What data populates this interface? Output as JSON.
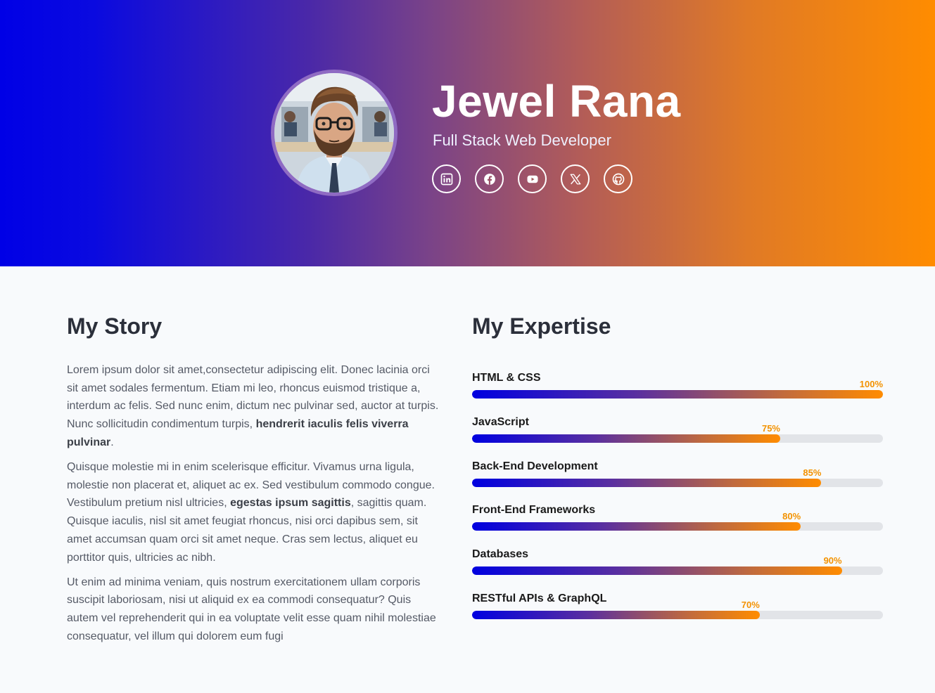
{
  "colors": {
    "gradient_start": "#0000e6",
    "gradient_end": "#ff8c00",
    "percent_text": "#f39200",
    "page_bg": "#f8fafc"
  },
  "hero": {
    "name": "Jewel Rana",
    "role": "Full Stack Web Developer",
    "avatar_icon": "avatar-portrait",
    "socials": [
      {
        "icon": "linkedin-icon"
      },
      {
        "icon": "facebook-icon"
      },
      {
        "icon": "youtube-icon"
      },
      {
        "icon": "x-twitter-icon"
      },
      {
        "icon": "github-icon"
      }
    ]
  },
  "story": {
    "title": "My Story",
    "paragraphs": [
      {
        "before": "Lorem ipsum dolor sit amet,consectetur adipiscing elit. Donec lacinia orci sit amet sodales fermentum. Etiam mi leo, rhoncus euismod tristique a, interdum ac felis. Sed nunc enim, dictum nec pulvinar sed, auctor at turpis. Nunc sollicitudin condimentum turpis, ",
        "bold": "hendrerit iaculis felis viverra pulvinar",
        "after": "."
      },
      {
        "before": "Quisque molestie mi in enim scelerisque efficitur. Vivamus urna ligula, molestie non placerat et, aliquet ac ex. Sed vestibulum commodo congue. Vestibulum pretium nisl ultricies, ",
        "bold": "egestas ipsum sagittis",
        "after": ", sagittis quam. Quisque iaculis, nisl sit amet feugiat rhoncus, nisi orci dapibus sem, sit amet accumsan quam orci sit amet neque. Cras sem lectus, aliquet eu porttitor quis, ultricies ac nibh."
      },
      {
        "before": "Ut enim ad minima veniam, quis nostrum exercitationem ullam corporis suscipit laboriosam, nisi ut aliquid ex ea commodi consequatur? Quis autem vel reprehenderit qui in ea voluptate velit esse quam nihil molestiae consequatur, vel illum qui dolorem eum fugi",
        "bold": "",
        "after": ""
      }
    ]
  },
  "expertise": {
    "title": "My Expertise",
    "skills": [
      {
        "label": "HTML & CSS",
        "percent": 100,
        "percent_text": "100%"
      },
      {
        "label": "JavaScript",
        "percent": 75,
        "percent_text": "75%"
      },
      {
        "label": "Back-End Development",
        "percent": 85,
        "percent_text": "85%"
      },
      {
        "label": "Front-End Frameworks",
        "percent": 80,
        "percent_text": "80%"
      },
      {
        "label": "Databases",
        "percent": 90,
        "percent_text": "90%"
      },
      {
        "label": "RESTful APIs & GraphQL",
        "percent": 70,
        "percent_text": "70%"
      }
    ]
  }
}
